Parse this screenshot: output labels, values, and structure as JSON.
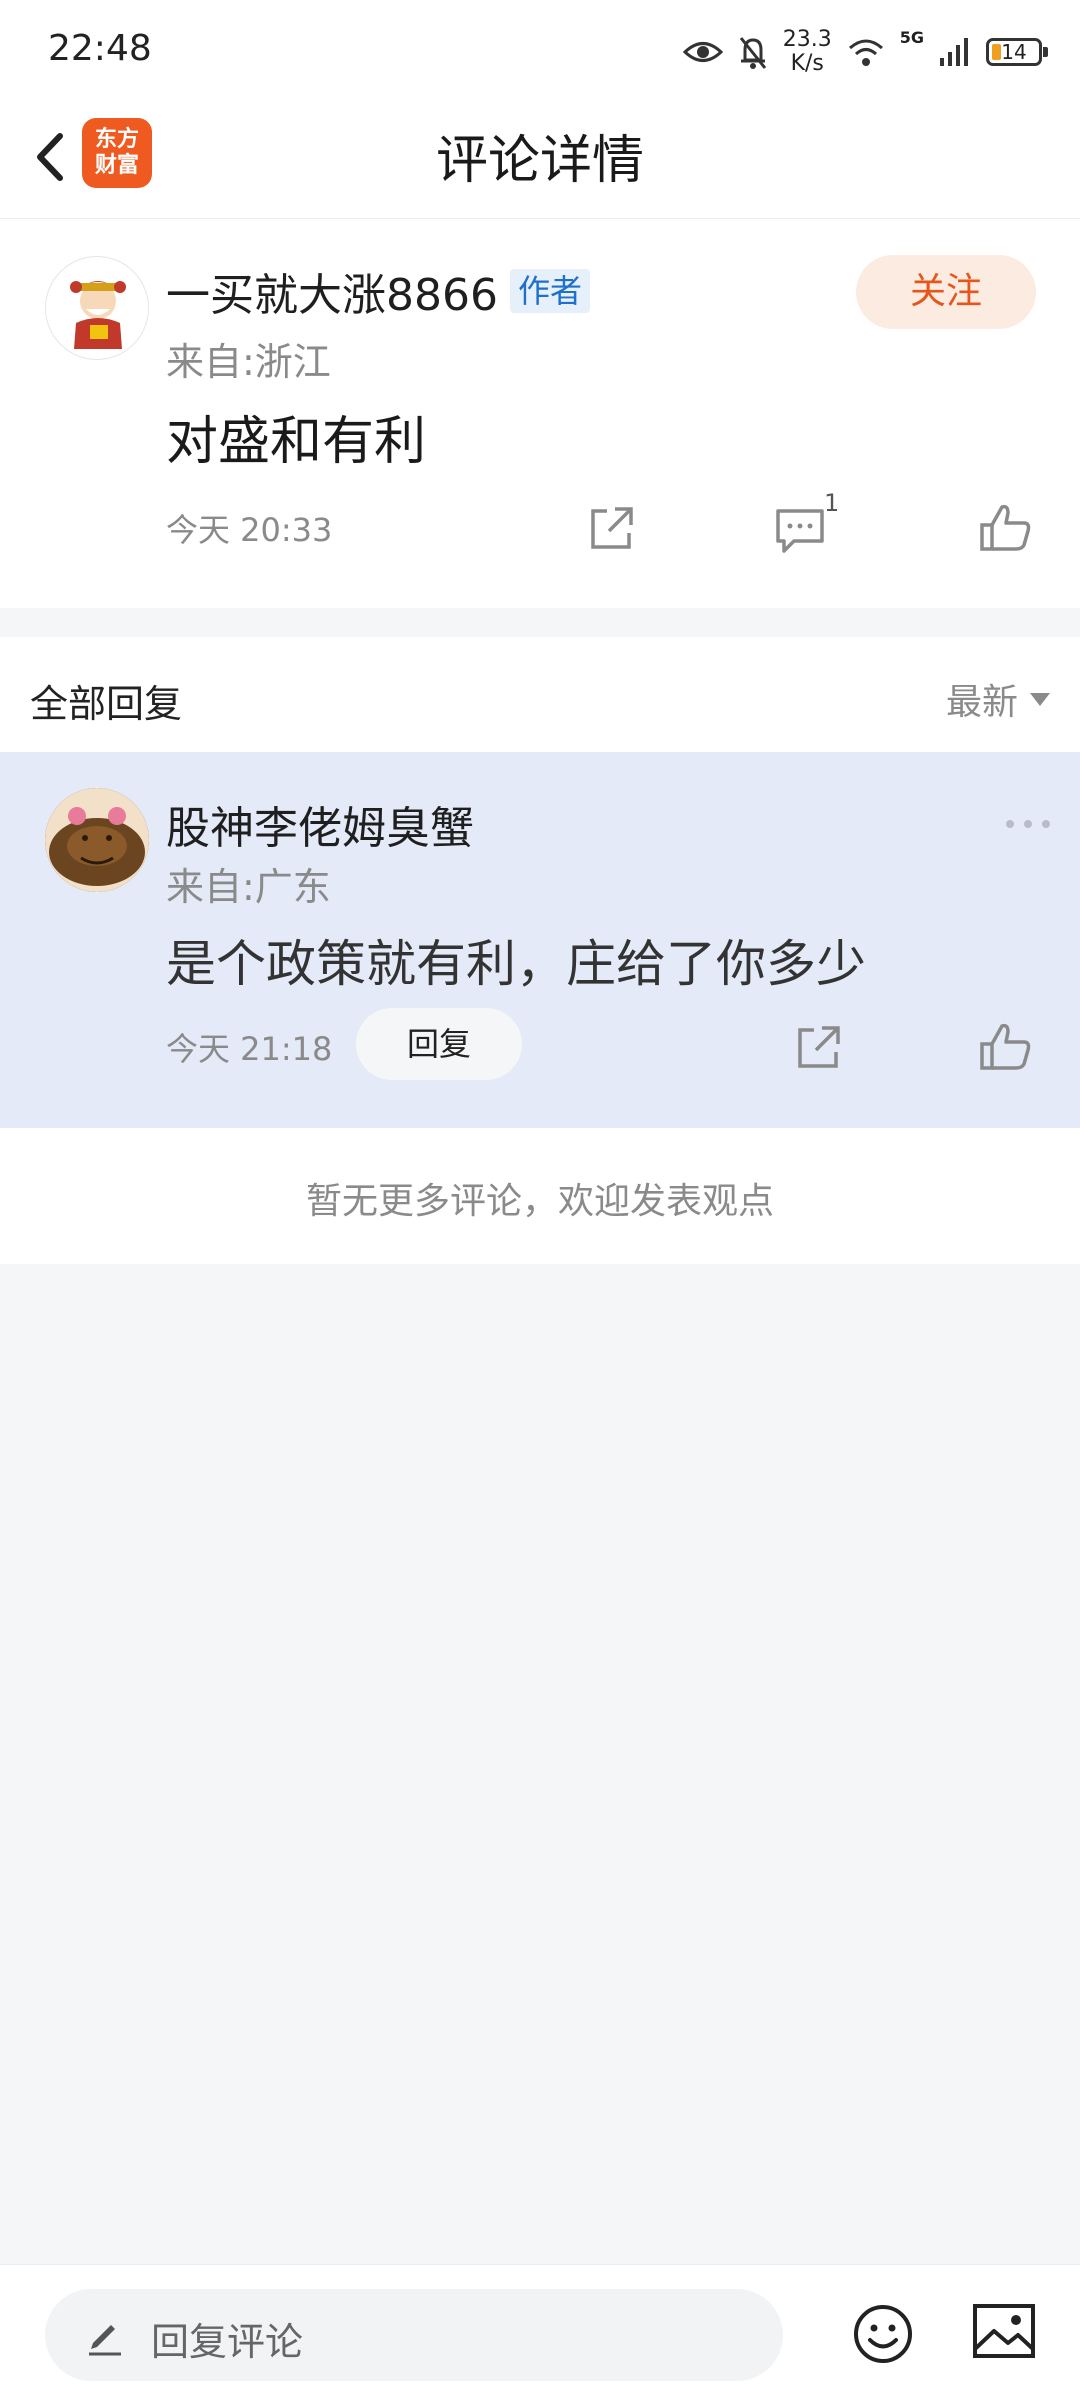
{
  "status_bar": {
    "time": "22:48",
    "speed_value": "23.3",
    "speed_unit": "K/s",
    "network": "5G",
    "battery": "14"
  },
  "header": {
    "title": "评论详情",
    "logo_line1": "东方",
    "logo_line2": "财富"
  },
  "comment": {
    "author": "一买就大涨8866",
    "author_tag": "作者",
    "follow_label": "关注",
    "location": "来自:浙江",
    "content": "对盛和有利",
    "time": "今天 20:33",
    "reply_count": "1"
  },
  "replies_section": {
    "title": "全部回复",
    "sort_label": "最新"
  },
  "reply": {
    "author": "股神李佬姆臭蟹",
    "location": "来自:广东",
    "content": "是个政策就有利，庄给了你多少",
    "time": "今天 21:18",
    "reply_button": "回复"
  },
  "end_message": "暂无更多评论，欢迎发表观点",
  "bottom_bar": {
    "placeholder": "回复评论"
  },
  "colors": {
    "accent": "#ee5a1f",
    "follow_bg": "#fcebe0",
    "reply_highlight": "#e4eaf7",
    "tag_blue": "#1f6fcc"
  },
  "icons": [
    "back-arrow-icon",
    "share-icon",
    "comment-icon",
    "like-icon",
    "more-icon",
    "pen-icon",
    "emoji-icon",
    "image-icon",
    "eye-icon",
    "mute-icon",
    "wifi-icon",
    "signal-icon",
    "battery-icon"
  ]
}
